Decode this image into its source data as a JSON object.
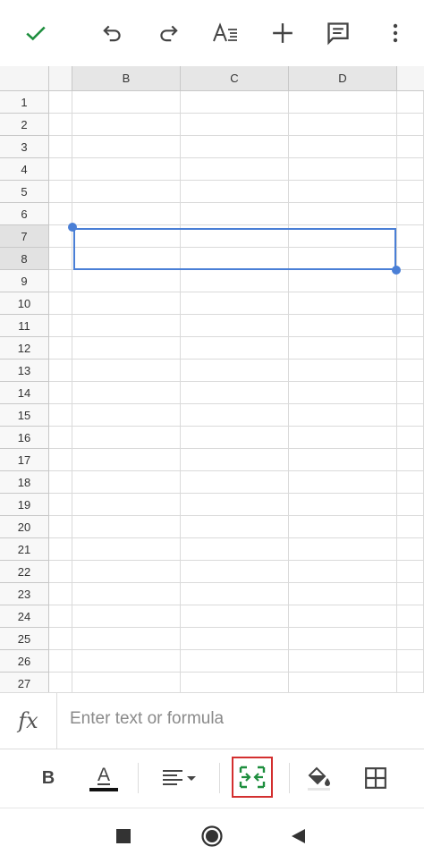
{
  "toolbar": {
    "icons": [
      "check-icon",
      "undo-icon",
      "redo-icon",
      "text-format-icon",
      "add-icon",
      "comment-icon",
      "more-vert-icon"
    ],
    "accent": "#1e8e3e"
  },
  "sheet": {
    "columns": [
      "B",
      "C",
      "D"
    ],
    "rows": [
      "1",
      "2",
      "3",
      "4",
      "5",
      "6",
      "7",
      "8",
      "9",
      "10",
      "11",
      "12",
      "13",
      "14",
      "15",
      "16",
      "17",
      "18",
      "19",
      "20",
      "21",
      "22",
      "23",
      "24",
      "25",
      "26",
      "27"
    ],
    "selected_rows": [
      "7",
      "8"
    ],
    "selection_color": "#4a7fd6"
  },
  "formula_bar": {
    "fx_label": "fx",
    "placeholder": "Enter text or formula"
  },
  "format_bar": {
    "bold_label": "B",
    "text_color_label": "A",
    "highlight_border": "#d32f2f"
  },
  "navbar": {
    "icons": [
      "recents-icon",
      "home-icon",
      "back-icon"
    ]
  }
}
